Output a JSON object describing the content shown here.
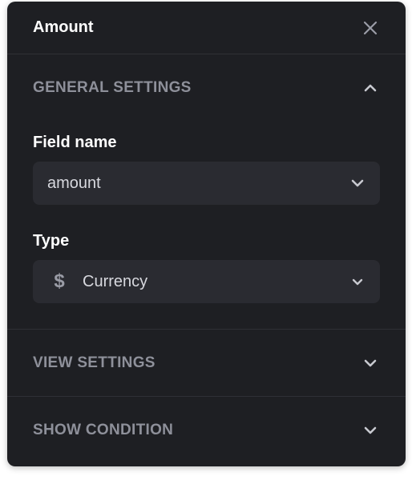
{
  "header": {
    "title": "Amount",
    "close_icon": "close-icon"
  },
  "sections": {
    "general": {
      "title": "GENERAL SETTINGS",
      "state": "expanded",
      "toggle_icon": "chevron-up-icon",
      "field_name": {
        "label": "Field name",
        "value": "amount",
        "icon": "chevron-down-icon"
      },
      "type": {
        "label": "Type",
        "value": "Currency",
        "leading_icon": "dollar-icon",
        "leading_glyph": "$",
        "icon": "chevron-down-icon"
      }
    },
    "view": {
      "title": "VIEW SETTINGS",
      "state": "collapsed",
      "toggle_icon": "chevron-down-icon"
    },
    "show_condition": {
      "title": "SHOW CONDITION",
      "state": "collapsed",
      "toggle_icon": "chevron-down-icon"
    }
  },
  "colors": {
    "panel_bg": "#1e1f23",
    "input_bg": "#2a2b31",
    "divider": "#2f3036",
    "section_title": "#8e909a",
    "text_primary": "#ffffff"
  }
}
